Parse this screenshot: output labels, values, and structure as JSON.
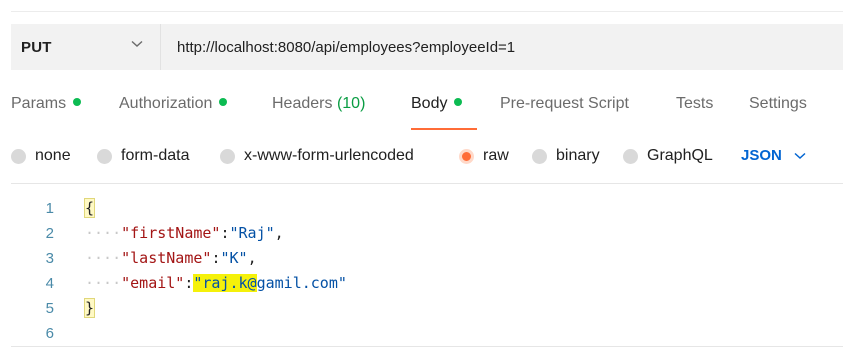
{
  "request": {
    "method": "PUT",
    "url": "http://localhost:8080/api/employees?employeeId=1"
  },
  "tabs": [
    {
      "label": "Params",
      "dot": true
    },
    {
      "label": "Authorization",
      "dot": true
    },
    {
      "label": "Headers",
      "count": "(10)"
    },
    {
      "label": "Body",
      "dot": true,
      "active": true
    },
    {
      "label": "Pre-request Script"
    },
    {
      "label": "Tests"
    },
    {
      "label": "Settings"
    }
  ],
  "body_modes": {
    "options": [
      "none",
      "form-data",
      "x-www-form-urlencoded",
      "raw",
      "binary",
      "GraphQL"
    ],
    "selected": "raw",
    "format": "JSON"
  },
  "editor": {
    "line_numbers": [
      "1",
      "2",
      "3",
      "4",
      "5",
      "6"
    ],
    "lines": [
      {
        "open": "{"
      },
      {
        "key": "\"firstName\"",
        "value": "\"Raj\"",
        "trail": ","
      },
      {
        "key": "\"lastName\"",
        "value": "\"K\"",
        "trail": ","
      },
      {
        "key": "\"email\"",
        "value_highlighted": "\"raj.k@",
        "value_rest": "gamil.com\"",
        "trail": ""
      },
      {
        "close": "}"
      },
      {}
    ]
  },
  "colors": {
    "accent": "#ff6c37",
    "status_dot": "#0cbb52",
    "link_blue": "#0265d2",
    "json_key": "#a31515",
    "json_string": "#0451a5",
    "highlight": "#f5f10a"
  }
}
